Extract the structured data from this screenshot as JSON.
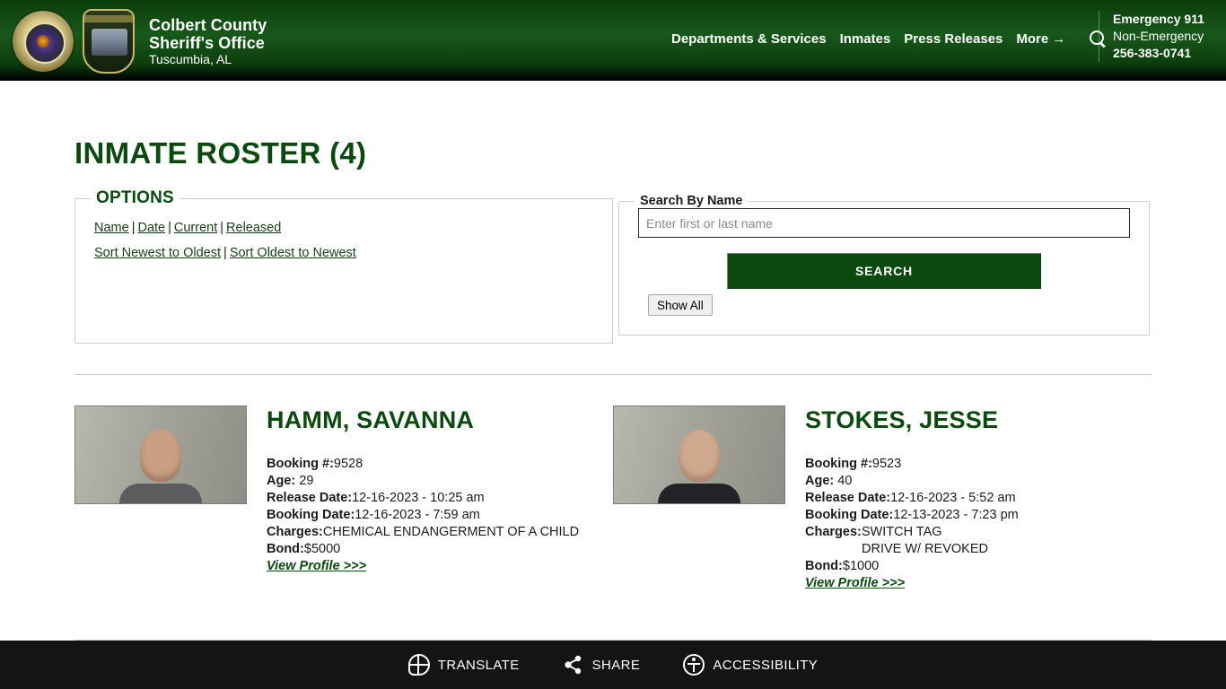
{
  "header": {
    "brand": {
      "line1": "Colbert County",
      "line2": "Sheriff's Office",
      "line3": "Tuscumbia, AL",
      "badge1_icon": "sheriff-star-badge-icon",
      "badge2_icon": "sheriff-shield-badge-icon"
    },
    "nav": [
      {
        "label": "Departments & Services"
      },
      {
        "label": "Inmates"
      },
      {
        "label": "Press Releases"
      },
      {
        "label": "More"
      }
    ],
    "more_arrow_icon": "arrow-right-icon",
    "search_icon": "search-icon",
    "emergency": {
      "line1": "Emergency 911",
      "line2": "Non-Emergency",
      "phone": "256-383-0741"
    }
  },
  "page": {
    "title": "INMATE ROSTER (4)"
  },
  "options": {
    "legend": "OPTIONS",
    "row1": [
      {
        "label": "Name"
      },
      {
        "label": "Date"
      },
      {
        "label": "Current"
      },
      {
        "label": "Released"
      }
    ],
    "row2": [
      {
        "label": "Sort Newest to Oldest"
      },
      {
        "label": "Sort Oldest to Newest"
      }
    ],
    "separator": "|"
  },
  "search": {
    "legend": "Search By Name",
    "placeholder": "Enter first or last name",
    "value": "",
    "button_label": "SEARCH",
    "show_all_label": "Show All"
  },
  "roster": {
    "labels": {
      "booking_no": "Booking #:",
      "age": "Age:",
      "release_date": "Release Date:",
      "booking_date": "Booking Date:",
      "charges": "Charges:",
      "bond": "Bond:",
      "view_profile": "View Profile >>>"
    },
    "inmates": [
      {
        "name": "HAMM, SAVANNA",
        "booking_no": "9528",
        "age": "29",
        "release_date": "12-16-2023 - 10:25 am",
        "booking_date": "12-16-2023 - 7:59 am",
        "charges": [
          "CHEMICAL ENDANGERMENT OF A CHILD"
        ],
        "bond": "$5000",
        "photo_alt": "mugshot-hamm-savanna"
      },
      {
        "name": "STOKES, JESSE",
        "booking_no": "9523",
        "age": "40",
        "release_date": "12-16-2023 - 5:52 am",
        "booking_date": "12-13-2023 - 7:23 pm",
        "charges": [
          "SWITCH TAG",
          "DRIVE W/ REVOKED"
        ],
        "bond": "$1000",
        "photo_alt": "mugshot-stokes-jesse"
      }
    ]
  },
  "footer": {
    "items": [
      {
        "label": "TRANSLATE",
        "icon": "globe-translate-icon"
      },
      {
        "label": "SHARE",
        "icon": "share-nodes-icon"
      },
      {
        "label": "ACCESSIBILITY",
        "icon": "accessibility-person-icon"
      }
    ]
  },
  "colors": {
    "brand_green": "#0b4a0e",
    "header_green": "#18581b",
    "footer_black": "#141414"
  }
}
